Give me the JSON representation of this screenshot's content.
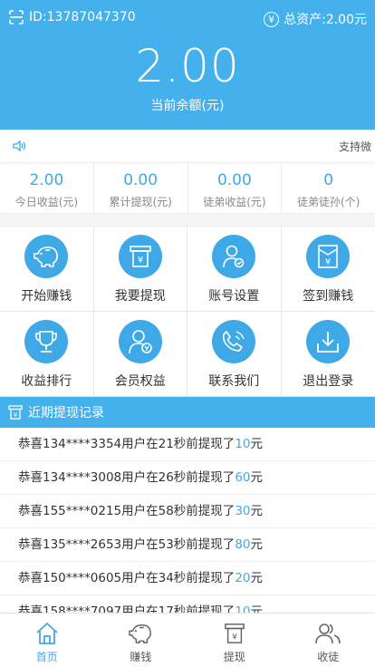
{
  "header": {
    "user_id": "ID:13787047370",
    "total_assets": "总资产:2.00元",
    "yen_symbol": "¥",
    "balance": "2.00",
    "balance_label": "当前余额(元)"
  },
  "notice": {
    "text": "支持微"
  },
  "stats": [
    {
      "value": "2.00",
      "label": "今日收益(元)"
    },
    {
      "value": "0.00",
      "label": "累计提现(元)"
    },
    {
      "value": "0.00",
      "label": "徒弟收益(元)"
    },
    {
      "value": "0",
      "label": "徒弟徒孙(个)"
    }
  ],
  "grid": [
    {
      "label": "开始赚钱",
      "icon": "piggy-bank-icon"
    },
    {
      "label": "我要提现",
      "icon": "withdraw-icon"
    },
    {
      "label": "账号设置",
      "icon": "account-settings-icon"
    },
    {
      "label": "签到赚钱",
      "icon": "checkin-icon"
    },
    {
      "label": "收益排行",
      "icon": "trophy-icon"
    },
    {
      "label": "会员权益",
      "icon": "member-icon"
    },
    {
      "label": "联系我们",
      "icon": "phone-icon"
    },
    {
      "label": "退出登录",
      "icon": "logout-icon"
    }
  ],
  "records_title": "近期提现记录",
  "records": [
    {
      "text": "恭喜134****3354用户在21秒前提现了",
      "amount": "10",
      "unit": "元"
    },
    {
      "text": "恭喜134****3008用户在26秒前提现了",
      "amount": "60",
      "unit": "元"
    },
    {
      "text": "恭喜155****0215用户在58秒前提现了",
      "amount": "30",
      "unit": "元"
    },
    {
      "text": "恭喜135****2653用户在53秒前提现了",
      "amount": "80",
      "unit": "元"
    },
    {
      "text": "恭喜150****0605用户在34秒前提现了",
      "amount": "20",
      "unit": "元"
    },
    {
      "text": "恭喜158****7097用户在17秒前提现了",
      "amount": "10",
      "unit": "元"
    }
  ],
  "tabs": [
    {
      "label": "首页",
      "icon": "home-icon",
      "active": true
    },
    {
      "label": "赚钱",
      "icon": "piggy-bank-icon",
      "active": false
    },
    {
      "label": "提现",
      "icon": "withdraw-icon",
      "active": false
    },
    {
      "label": "收徒",
      "icon": "apprentice-icon",
      "active": false
    }
  ],
  "colors": {
    "primary": "#45b1ec",
    "accent_text": "#45a8e2"
  }
}
